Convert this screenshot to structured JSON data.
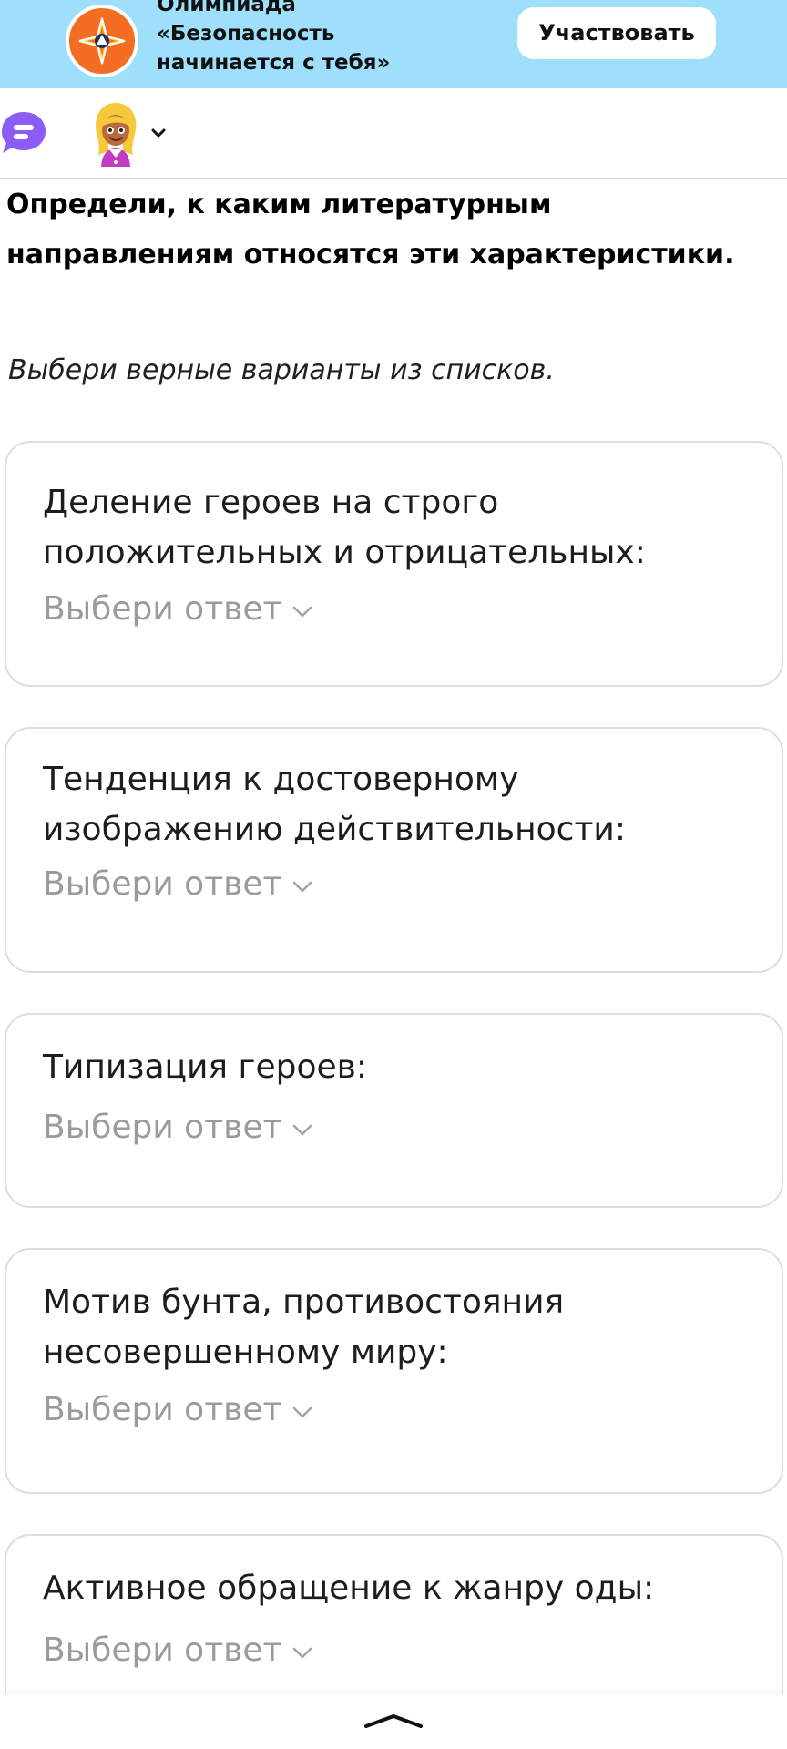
{
  "banner": {
    "title": "Олимпиада\n«Безопасность\nначинается с тебя»",
    "button_label": "Участвовать",
    "background_color": "#9ee0fb",
    "emblem_color": "#f36e22",
    "emblem_icon": "compass-star-emblem-icon"
  },
  "toolbar": {
    "chat_icon": "chat-bubble-icon",
    "chat_color": "#8b5cf6",
    "avatar_icon": "girl-avatar-icon",
    "menu_icon": "chevron-down-icon"
  },
  "task": {
    "title": "Определи, к каким литературным направлениям относятся эти характеристики.",
    "instruction": "Выбери верные варианты из списков."
  },
  "cards": [
    {
      "label": "Деление героев на строго положительных и отрицательных:",
      "select": {
        "value": "Выбери ответ",
        "icon": "chevron-down-icon"
      }
    },
    {
      "label": "Тенденция к достоверному изображению действительности:",
      "select": {
        "value": "Выбери ответ",
        "icon": "chevron-down-icon"
      }
    },
    {
      "label": "Типизация героев:",
      "select": {
        "value": "Выбери ответ",
        "icon": "chevron-down-icon"
      }
    },
    {
      "label": "Мотив бунта, противостояния несовершенному миру:",
      "select": {
        "value": "Выбери ответ",
        "icon": "chevron-down-icon"
      }
    },
    {
      "label": "Активное обращение к жанру оды:",
      "select": {
        "value": "Выбери ответ",
        "icon": "chevron-down-icon"
      }
    }
  ],
  "bottom_bar": {
    "handle_icon": "chevron-up-icon"
  }
}
